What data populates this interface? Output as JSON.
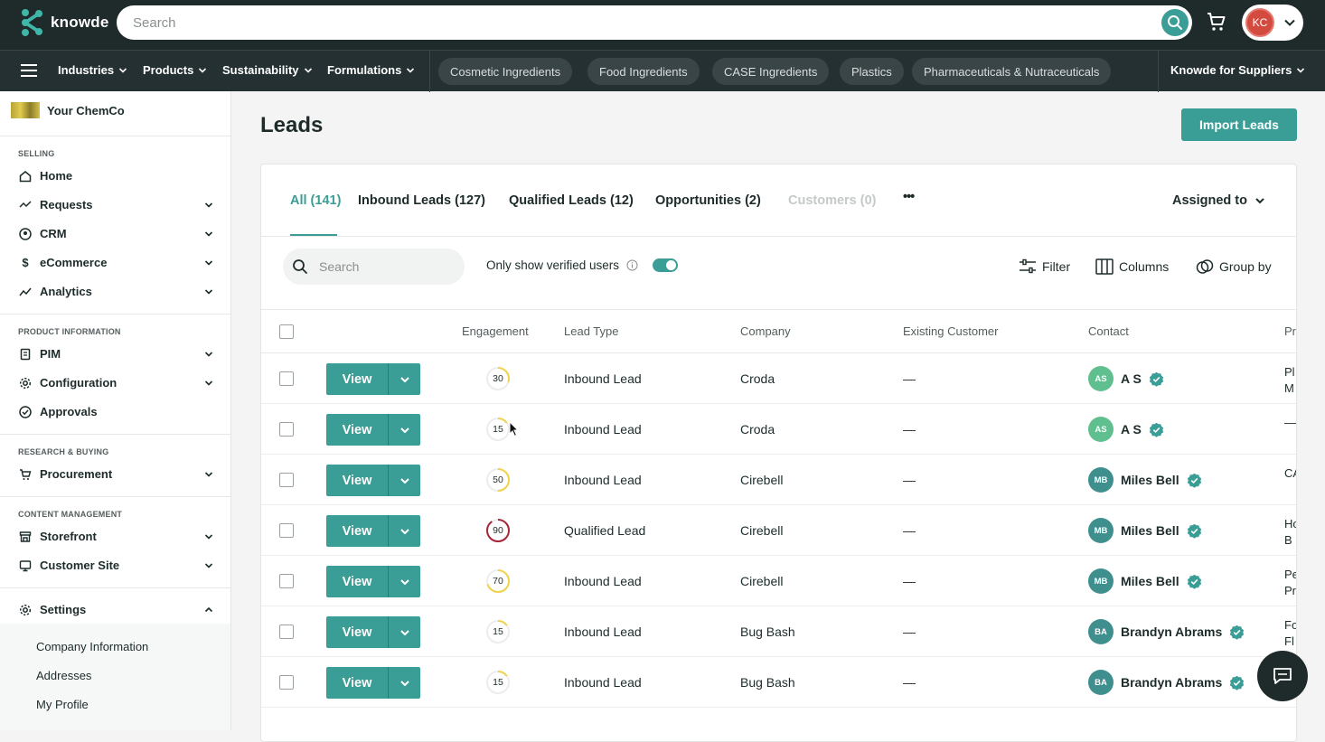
{
  "header": {
    "logo_text": "knowde",
    "search_placeholder": "Search",
    "user_initials": "KC"
  },
  "nav": {
    "items": [
      "Industries",
      "Products",
      "Sustainability",
      "Formulations"
    ],
    "pills": [
      "Cosmetic Ingredients",
      "Food Ingredients",
      "CASE Ingredients",
      "Plastics",
      "Pharmaceuticals & Nutraceuticals"
    ],
    "suppliers": "Knowde for Suppliers"
  },
  "sidebar": {
    "company": "Your ChemCo",
    "sections": {
      "selling": "SELLING",
      "product_info": "PRODUCT INFORMATION",
      "research": "RESEARCH & BUYING",
      "content": "CONTENT MANAGEMENT"
    },
    "items": {
      "home": "Home",
      "requests": "Requests",
      "crm": "CRM",
      "ecommerce": "eCommerce",
      "analytics": "Analytics",
      "pim": "PIM",
      "configuration": "Configuration",
      "approvals": "Approvals",
      "procurement": "Procurement",
      "storefront": "Storefront",
      "customer_site": "Customer Site",
      "settings": "Settings"
    },
    "subitems": [
      "Company Information",
      "Addresses",
      "My Profile"
    ]
  },
  "main": {
    "title": "Leads",
    "import_button": "Import Leads",
    "tabs": {
      "all": "All (141)",
      "inbound": "Inbound Leads (127)",
      "qualified": "Qualified Leads (12)",
      "opportunities": "Opportunities (2)",
      "customers": "Customers (0)",
      "more": "•••"
    },
    "assigned_to": "Assigned to",
    "table_search_placeholder": "Search",
    "verified_toggle_label": "Only show verified users",
    "verified_toggle_on": true,
    "tools": {
      "filter": "Filter",
      "columns": "Columns",
      "group_by": "Group by"
    },
    "columns": {
      "engagement": "Engagement",
      "lead_type": "Lead Type",
      "company": "Company",
      "existing_customer": "Existing Customer",
      "contact": "Contact",
      "product": "Pr"
    },
    "view_label": "View",
    "rows": [
      {
        "engagement": "30",
        "lead_type": "Inbound Lead",
        "company": "Croda",
        "existing": "—",
        "initials": "AS",
        "contact": "A S",
        "product": "Pl M"
      },
      {
        "engagement": "15",
        "lead_type": "Inbound Lead",
        "company": "Croda",
        "existing": "—",
        "initials": "AS",
        "contact": "A S",
        "product": "—"
      },
      {
        "engagement": "50",
        "lead_type": "Inbound Lead",
        "company": "Cirebell",
        "existing": "—",
        "initials": "MB",
        "contact": "Miles Bell",
        "product": "CA"
      },
      {
        "engagement": "90",
        "lead_type": "Qualified Lead",
        "company": "Cirebell",
        "existing": "—",
        "initials": "MB",
        "contact": "Miles Bell",
        "product": "Ho B"
      },
      {
        "engagement": "70",
        "lead_type": "Inbound Lead",
        "company": "Cirebell",
        "existing": "—",
        "initials": "MB",
        "contact": "Miles Bell",
        "product": "Pe Pr"
      },
      {
        "engagement": "15",
        "lead_type": "Inbound Lead",
        "company": "Bug Bash",
        "existing": "—",
        "initials": "BA",
        "contact": "Brandyn Abrams",
        "product": "Fo Fl"
      },
      {
        "engagement": "15",
        "lead_type": "Inbound Lead",
        "company": "Bug Bash",
        "existing": "—",
        "initials": "BA",
        "contact": "Brandyn Abrams",
        "product": ""
      }
    ]
  },
  "colors": {
    "accent": "#3a9e96",
    "header_bg": "#1f2a2b",
    "engagement_low": "#f0d34a",
    "engagement_high": "#a5283a"
  }
}
